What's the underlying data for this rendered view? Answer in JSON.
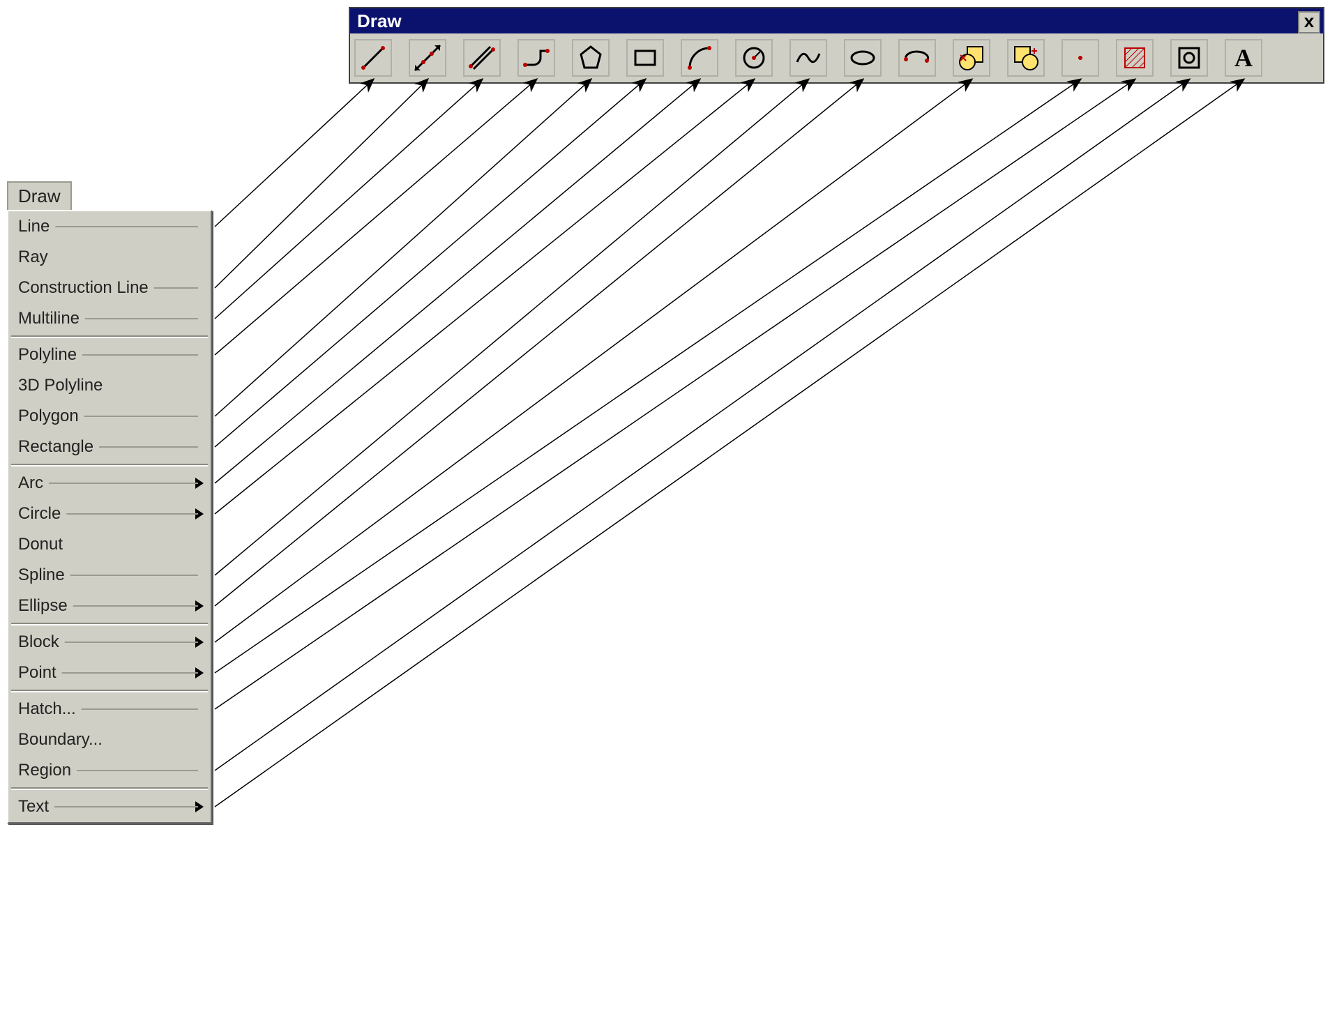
{
  "toolbar": {
    "title": "Draw",
    "close_label": "x",
    "buttons": [
      {
        "name": "line-icon"
      },
      {
        "name": "construction-line-icon"
      },
      {
        "name": "multiline-icon"
      },
      {
        "name": "polyline-icon"
      },
      {
        "name": "polygon-icon"
      },
      {
        "name": "rectangle-icon"
      },
      {
        "name": "arc-icon"
      },
      {
        "name": "circle-icon"
      },
      {
        "name": "spline-icon"
      },
      {
        "name": "ellipse-icon"
      },
      {
        "name": "ellipse-arc-icon"
      },
      {
        "name": "insert-block-icon"
      },
      {
        "name": "make-block-icon"
      },
      {
        "name": "point-icon"
      },
      {
        "name": "hatch-icon"
      },
      {
        "name": "region-icon"
      },
      {
        "name": "text-icon"
      }
    ]
  },
  "menu": {
    "title": "Draw",
    "items": [
      {
        "label": "Line",
        "submenu": false
      },
      {
        "label": "Ray",
        "submenu": false
      },
      {
        "label": "Construction Line",
        "submenu": false
      },
      {
        "label": "Multiline",
        "submenu": false
      },
      {
        "sep": true
      },
      {
        "label": "Polyline",
        "submenu": false
      },
      {
        "label": "3D Polyline",
        "submenu": false
      },
      {
        "label": "Polygon",
        "submenu": false
      },
      {
        "label": "Rectangle",
        "submenu": false
      },
      {
        "sep": true
      },
      {
        "label": "Arc",
        "submenu": true
      },
      {
        "label": "Circle",
        "submenu": true
      },
      {
        "label": "Donut",
        "submenu": false
      },
      {
        "label": "Spline",
        "submenu": false
      },
      {
        "label": "Ellipse",
        "submenu": true
      },
      {
        "sep": true
      },
      {
        "label": "Block",
        "submenu": true
      },
      {
        "label": "Point",
        "submenu": true
      },
      {
        "sep": true
      },
      {
        "label": "Hatch...",
        "submenu": false
      },
      {
        "label": "Boundary...",
        "submenu": false
      },
      {
        "label": "Region",
        "submenu": false
      },
      {
        "sep": true
      },
      {
        "label": "Text",
        "submenu": true
      }
    ]
  },
  "connectors": [
    {
      "menu": "Line",
      "tool": 0
    },
    {
      "menu": "Construction Line",
      "tool": 1
    },
    {
      "menu": "Multiline",
      "tool": 2
    },
    {
      "menu": "Polyline",
      "tool": 3
    },
    {
      "menu": "Polygon",
      "tool": 4
    },
    {
      "menu": "Rectangle",
      "tool": 5
    },
    {
      "menu": "Arc",
      "tool": 6
    },
    {
      "menu": "Circle",
      "tool": 7
    },
    {
      "menu": "Spline",
      "tool": 8
    },
    {
      "menu": "Ellipse",
      "tool": 9
    },
    {
      "menu": "Block",
      "tool": 11
    },
    {
      "menu": "Point",
      "tool": 13
    },
    {
      "menu": "Hatch...",
      "tool": 14
    },
    {
      "menu": "Region",
      "tool": 15
    },
    {
      "menu": "Text",
      "tool": 16
    }
  ]
}
